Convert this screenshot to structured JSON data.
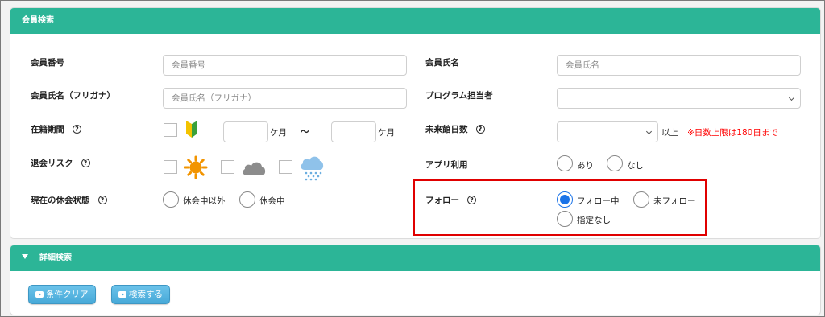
{
  "search_panel": {
    "title": "会員検索"
  },
  "fields": {
    "member_number": {
      "label": "会員番号",
      "placeholder": "会員番号"
    },
    "member_name": {
      "label": "会員氏名",
      "placeholder": "会員氏名"
    },
    "member_name_kana": {
      "label": "会員氏名（フリガナ）",
      "placeholder": "会員氏名（フリガナ）"
    },
    "program_staff": {
      "label": "プログラム担当者",
      "value": ""
    },
    "enrollment_period": {
      "label": "在籍期間",
      "from_value": "",
      "from_unit": "ケ月",
      "separator": "～",
      "to_value": "",
      "to_unit": "ケ月"
    },
    "days_not_visited": {
      "label": "未来館日数",
      "value": "",
      "suffix": "以上",
      "note": "※日数上限は180日まで",
      "note_color": "#ff0000"
    },
    "withdrawal_risk": {
      "label": "退会リスク",
      "icons": [
        "beginner-mark-icon",
        "sun-icon",
        "cloud-icon",
        "rain-cloud-icon"
      ]
    },
    "app_usage": {
      "label": "アプリ利用",
      "options": [
        "あり",
        "なし"
      ]
    },
    "current_leave_status": {
      "label": "現在の休会状態",
      "options": [
        "休会中以外",
        "休会中"
      ]
    },
    "follow": {
      "label": "フォロー",
      "options": [
        "フォロー中",
        "未フォロー",
        "指定なし"
      ],
      "selected": "フォロー中"
    }
  },
  "help_symbol": "?",
  "advanced_panel": {
    "title": "詳細検索"
  },
  "buttons": {
    "clear": "条件クリア",
    "search": "検索する"
  },
  "colors": {
    "header": "#2cb597",
    "button": "#47a9d8",
    "highlight": "#e00000",
    "radio_selected": "#1a73e8"
  }
}
